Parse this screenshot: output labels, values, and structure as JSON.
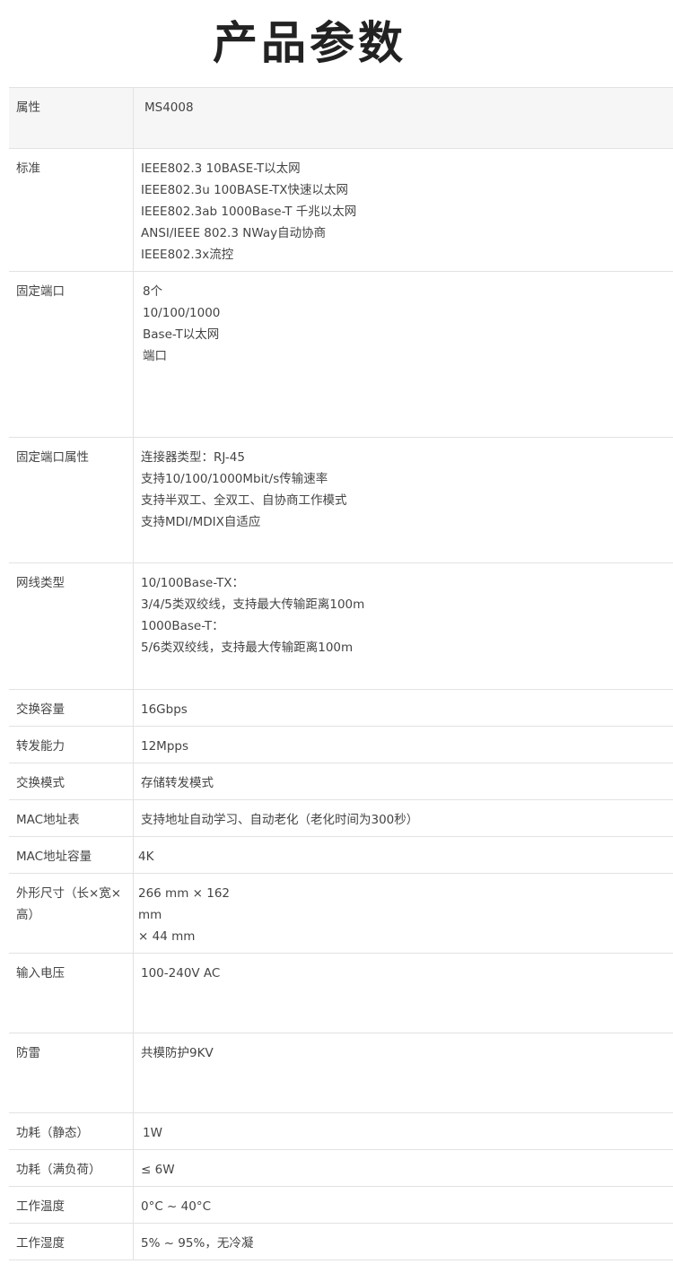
{
  "title": "产品参数",
  "rows": [
    {
      "label": "属性",
      "lines": [
        "MS4008"
      ]
    },
    {
      "label": "标准",
      "lines": [
        "IEEE802.3 10BASE-T以太网",
        "IEEE802.3u 100BASE-TX快速以太网",
        "IEEE802.3ab 1000Base-T 千兆以太网",
        "ANSI/IEEE 802.3 NWay自动协商",
        "IEEE802.3x流控"
      ]
    },
    {
      "label": "固定端口",
      "lines": [
        "8个",
        "10/100/1000",
        "Base-T以太网",
        "端口"
      ]
    },
    {
      "label": "固定端口属性",
      "lines": [
        "连接器类型：RJ-45",
        "支持10/100/1000Mbit/s传输速率",
        "支持半双工、全双工、自协商工作模式",
        "支持MDI/MDIX自适应"
      ]
    },
    {
      "label": "网线类型",
      "lines": [
        "10/100Base-TX：",
        "3/4/5类双绞线，支持最大传输距离100m",
        "1000Base-T：",
        "5/6类双绞线，支持最大传输距离100m"
      ]
    },
    {
      "label": "交换容量",
      "lines": [
        "16Gbps"
      ]
    },
    {
      "label": "转发能力",
      "lines": [
        "12Mpps"
      ]
    },
    {
      "label": "交换模式",
      "lines": [
        "存储转发模式"
      ]
    },
    {
      "label": "MAC地址表",
      "lines": [
        "支持地址自动学习、自动老化（老化时间为300秒）"
      ]
    },
    {
      "label": "MAC地址容量",
      "lines": [
        "4K"
      ]
    },
    {
      "label": "外形尺寸（长×宽×高）",
      "lines": [
        "266 mm × 162",
        "mm",
        "× 44 mm"
      ]
    },
    {
      "label": "输入电压",
      "lines": [
        "100-240V AC"
      ]
    },
    {
      "label": "防雷",
      "lines": [
        "共模防护9KV"
      ]
    },
    {
      "label": "功耗（静态）",
      "lines": [
        "1W"
      ]
    },
    {
      "label": "功耗（满负荷）",
      "lines": [
        "≤ 6W"
      ]
    },
    {
      "label": "工作温度",
      "lines": [
        "0°C ~ 40°C"
      ]
    },
    {
      "label": "工作湿度",
      "lines": [
        "5% ~ 95%，无冷凝"
      ]
    }
  ]
}
